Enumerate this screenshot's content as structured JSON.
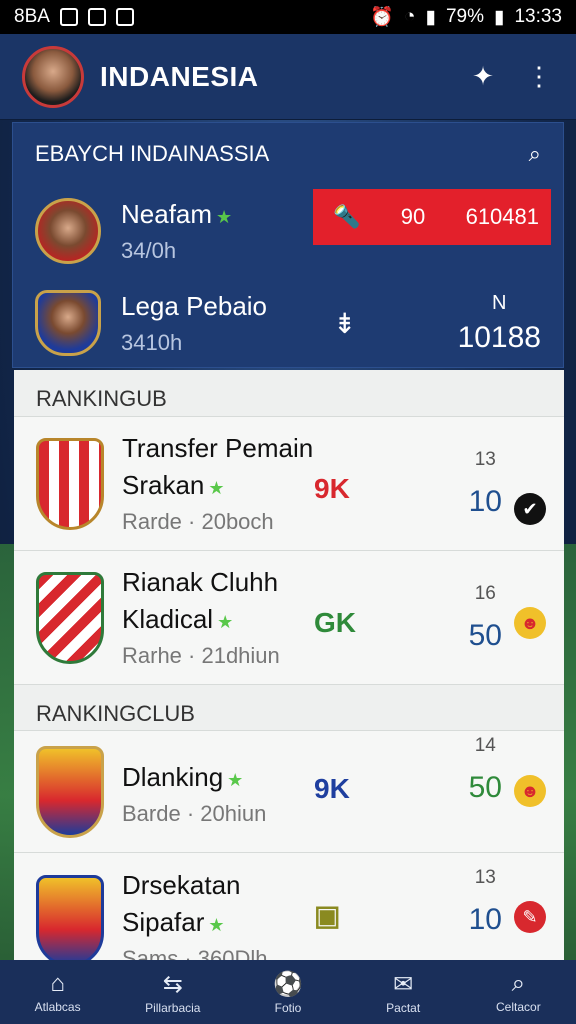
{
  "status_bar": {
    "carrier": "8BA",
    "battery": "79%",
    "time": "13:33"
  },
  "app_bar": {
    "title": "INDANESIA",
    "action_icon": "rocket-icon",
    "menu_icon": "more-vert-icon"
  },
  "top_panel": {
    "header": "EBAYCH INDAINASSIA",
    "rows": [
      {
        "name": "Neafam",
        "sub": "34/0h",
        "score_left": "90",
        "score_right": "610481"
      },
      {
        "name": "Lega Pebaio",
        "sub": "3410h",
        "arrow": "⇟",
        "right_label": "N",
        "right_value": "10188"
      }
    ]
  },
  "list": {
    "sections": [
      {
        "title": "RANKINGUB",
        "cards": [
          {
            "line1": "Transfer Pemain",
            "line2": "Srakan",
            "line3": "Rarde · 20boch",
            "mid": "9K",
            "mid_color": "#d8282e",
            "small": "13",
            "big": "10",
            "big_color": "#1f4f8f",
            "icon_bg": "#111111",
            "icon_glyph": "✔"
          },
          {
            "line1": "Rianak Cluhh",
            "line2": "Kladical",
            "line3": "Rarhe · 21dhiun",
            "mid": "GK",
            "mid_color": "#2f8a3a",
            "small": "16",
            "big": "50",
            "big_color": "#1f4f8f",
            "icon_bg": "#f0c02a",
            "icon_glyph": "☻"
          }
        ]
      },
      {
        "title": "RANKINGCLUB",
        "cards": [
          {
            "line1": "",
            "line2": "Dlanking",
            "line3": "Barde · 20hiun",
            "mid": "9K",
            "mid_color": "#1f3f9f",
            "small": "14",
            "big": "50",
            "big_color": "#2f8a3a",
            "icon_bg": "#f0c02a",
            "icon_glyph": "☻"
          },
          {
            "line1": "Drsekatan",
            "line2": "Sipafar",
            "line3": "Sams · 360Dlh",
            "mid": "▣",
            "mid_color": "#8a8a20",
            "small": "13",
            "big": "10",
            "big_color": "#1f4f8f",
            "icon_bg": "#d8282e",
            "icon_glyph": "✎"
          }
        ]
      }
    ]
  },
  "bottom_nav": [
    {
      "label": "Atlabcas",
      "icon": "home-icon",
      "glyph": "⌂"
    },
    {
      "label": "Pillarbacia",
      "icon": "transfer-icon",
      "glyph": "⇆"
    },
    {
      "label": "Fotio",
      "icon": "ball-icon",
      "glyph": "⚽"
    },
    {
      "label": "Pactat",
      "icon": "profile-icon",
      "glyph": "✉"
    },
    {
      "label": "Celtacor",
      "icon": "search-icon",
      "glyph": "⌕"
    }
  ]
}
